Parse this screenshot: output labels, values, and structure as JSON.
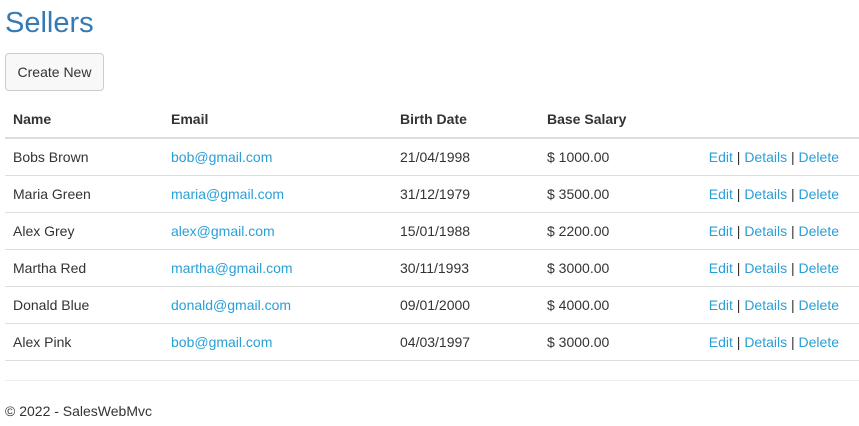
{
  "page": {
    "title": "Sellers",
    "create_label": "Create New"
  },
  "table": {
    "headers": {
      "name": "Name",
      "email": "Email",
      "birth_date": "Birth Date",
      "base_salary": "Base Salary"
    },
    "action_labels": {
      "edit": "Edit",
      "details": "Details",
      "delete": "Delete",
      "separator": "|"
    },
    "rows": [
      {
        "name": "Bobs Brown",
        "email": "bob@gmail.com",
        "birth_date": "21/04/1998",
        "base_salary": "$ 1000.00"
      },
      {
        "name": "Maria Green",
        "email": "maria@gmail.com",
        "birth_date": "31/12/1979",
        "base_salary": "$ 3500.00"
      },
      {
        "name": "Alex Grey",
        "email": "alex@gmail.com",
        "birth_date": "15/01/1988",
        "base_salary": "$ 2200.00"
      },
      {
        "name": "Martha Red",
        "email": "martha@gmail.com",
        "birth_date": "30/11/1993",
        "base_salary": "$ 3000.00"
      },
      {
        "name": "Donald Blue",
        "email": "donald@gmail.com",
        "birth_date": "09/01/2000",
        "base_salary": "$ 4000.00"
      },
      {
        "name": "Alex Pink",
        "email": "bob@gmail.com",
        "birth_date": "04/03/1997",
        "base_salary": "$ 3000.00"
      }
    ]
  },
  "footer": {
    "text": "© 2022 - SalesWebMvc"
  },
  "colors": {
    "title": "#337ab7",
    "link": "#2a9fd6",
    "text": "#333333",
    "border": "#dddddd"
  }
}
